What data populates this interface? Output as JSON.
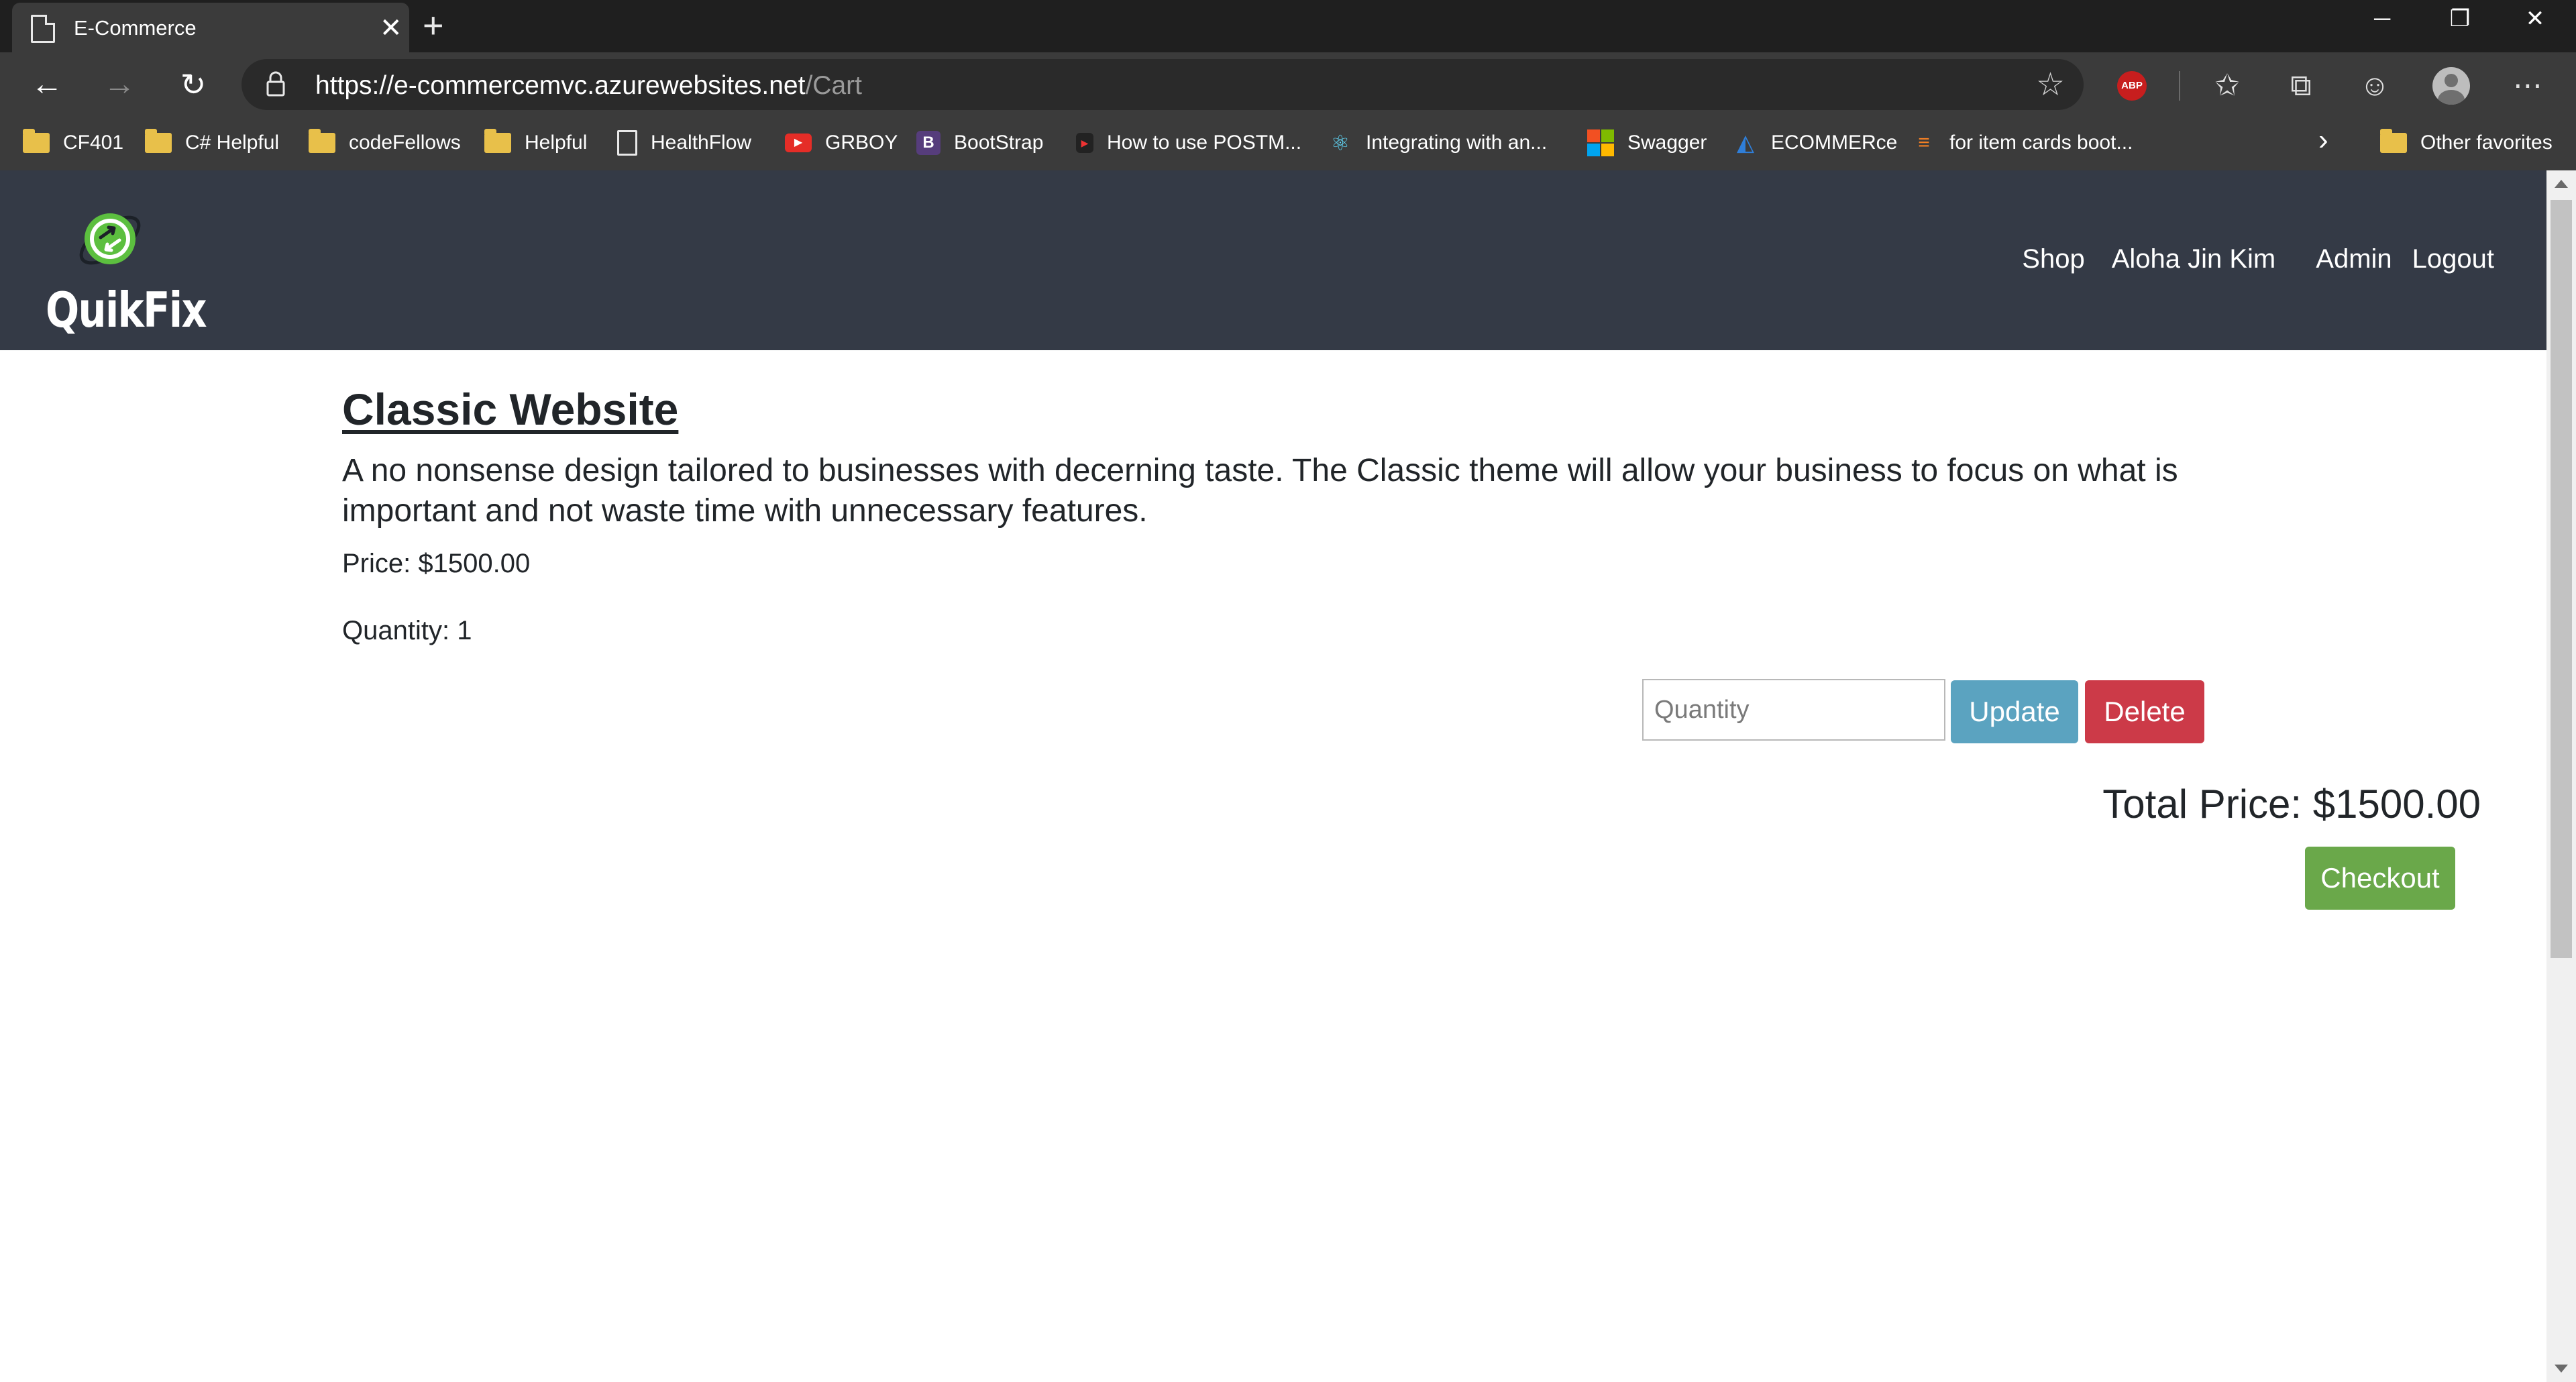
{
  "browser": {
    "tab_title": "E-Commerce",
    "url_host": "https://e-commercemvc.azurewebsites.net",
    "url_path": "/Cart",
    "favorites": [
      {
        "label": "CF401",
        "icon": "folder-icon"
      },
      {
        "label": "C# Helpful",
        "icon": "folder-icon"
      },
      {
        "label": "codeFellows",
        "icon": "folder-icon"
      },
      {
        "label": "Helpful",
        "icon": "folder-icon"
      },
      {
        "label": "HealthFlow",
        "icon": "page-icon"
      },
      {
        "label": "GRBOY",
        "icon": "youtube-icon"
      },
      {
        "label": "BootStrap",
        "icon": "bootstrap-icon"
      },
      {
        "label": "How to use POSTM...",
        "icon": "video-icon"
      },
      {
        "label": "Integrating with an...",
        "icon": "react-icon"
      },
      {
        "label": "Swagger",
        "icon": "microsoft-icon"
      },
      {
        "label": "ECOMMERce",
        "icon": "azure-devops-icon"
      },
      {
        "label": "for item cards boot...",
        "icon": "stackoverflow-icon"
      }
    ],
    "other_favorites": "Other favorites",
    "abp_label": "ABP"
  },
  "site": {
    "brand": "QuikFix",
    "nav": {
      "shop": "Shop",
      "user": "Aloha Jin Kim",
      "admin": "Admin",
      "logout": "Logout"
    }
  },
  "cart": {
    "item": {
      "title": "Classic Website",
      "description": "A no nonsense design tailored to businesses with decerning taste. The Classic theme will allow your business to focus on what is important and not waste time with unnecessary features.",
      "price_text": "Price: $1500.00",
      "quantity_text": "Quantity: 1"
    },
    "quantity_placeholder": "Quantity",
    "update_label": "Update",
    "delete_label": "Delete",
    "total_text": "Total Price: $1500.00",
    "checkout_label": "Checkout"
  },
  "colors": {
    "navbar": "#343a46",
    "update": "#5ba3c0",
    "delete": "#cc3a48",
    "checkout": "#6aa84a"
  }
}
